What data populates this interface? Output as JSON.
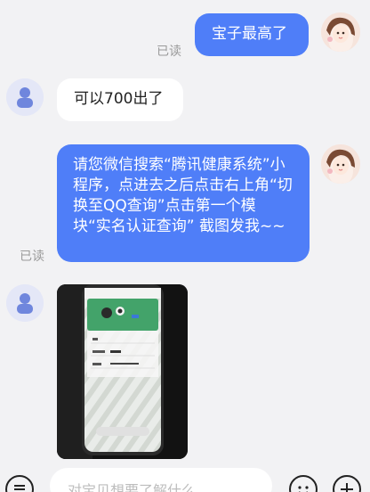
{
  "messages": {
    "m1": {
      "text": "宝子最高了",
      "status": "已读"
    },
    "m2": {
      "text": "可以700出了"
    },
    "m3": {
      "text": "请您微信搜索“腾讯健康系统”小程序，点进去之后点击右上角“切换至QQ查询”点击第一个模块“实名认证查询” 截图发我~~",
      "status": "已读"
    }
  },
  "input": {
    "placeholder": "对宝贝想要了解什么"
  },
  "icons": {
    "menu": "menu-icon",
    "emoji": "emoji-icon",
    "add": "plus-icon"
  },
  "colors": {
    "accent": "#4f7ef8",
    "background": "#f2f2f4",
    "incoming": "#ffffff"
  }
}
